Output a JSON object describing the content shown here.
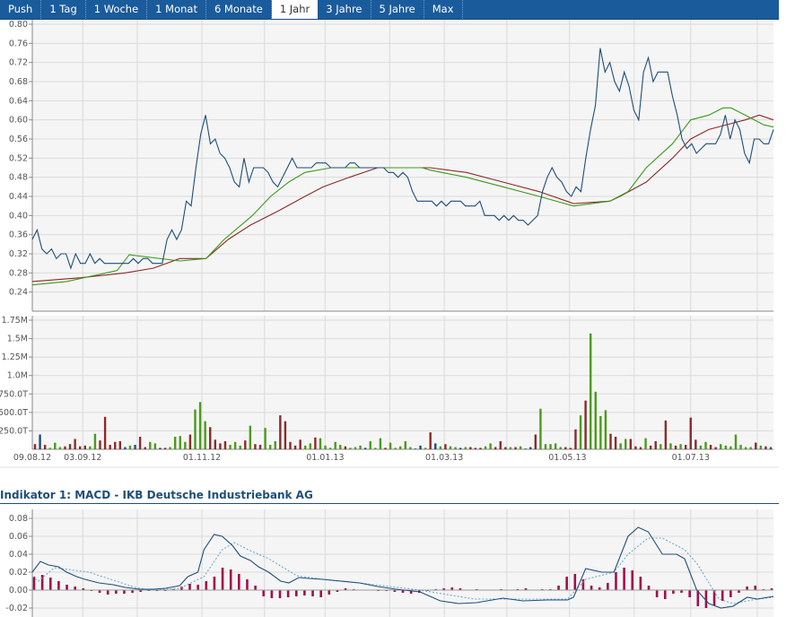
{
  "tabs": [
    {
      "label": "Push"
    },
    {
      "label": "1 Tag"
    },
    {
      "label": "1 Woche"
    },
    {
      "label": "1 Monat"
    },
    {
      "label": "6 Monate"
    },
    {
      "label": "1 Jahr",
      "active": true
    },
    {
      "label": "3 Jahre"
    },
    {
      "label": "5 Jahre"
    },
    {
      "label": "Max"
    }
  ],
  "indicator_title": "Indikator 1: MACD - IKB Deutsche Industriebank AG",
  "colors": {
    "price": "#1f4e78",
    "ma_short": "#3a9a1a",
    "ma_long": "#8b2a2a",
    "vol_up": "#4a9a1a",
    "vol_down": "#8b2a2a",
    "vol_neutral": "#1f4e78",
    "macd": "#1f4e78",
    "signal": "#6aaad0",
    "hist": "#a0104a"
  },
  "chart_data": [
    {
      "type": "line",
      "title": "Price",
      "x_unit": "days since 09.08.12",
      "xlim": [
        0,
        367
      ],
      "ylim": [
        0.2,
        0.8
      ],
      "yticks": [
        "0.80",
        "0.76",
        "0.72",
        "0.68",
        "0.64",
        "0.60",
        "0.56",
        "0.52",
        "0.48",
        "0.44",
        "0.40",
        "0.36",
        "0.32",
        "0.28",
        "0.24"
      ],
      "close": [
        0.35,
        0.37,
        0.33,
        0.32,
        0.33,
        0.31,
        0.32,
        0.32,
        0.29,
        0.32,
        0.3,
        0.3,
        0.32,
        0.3,
        0.31,
        0.3,
        0.3,
        0.3,
        0.3,
        0.3,
        0.3,
        0.31,
        0.3,
        0.31,
        0.31,
        0.3,
        0.3,
        0.3,
        0.35,
        0.37,
        0.35,
        0.37,
        0.43,
        0.42,
        0.5,
        0.57,
        0.61,
        0.55,
        0.56,
        0.53,
        0.52,
        0.5,
        0.47,
        0.46,
        0.52,
        0.47,
        0.5,
        0.5,
        0.5,
        0.49,
        0.47,
        0.46,
        0.48,
        0.5,
        0.52,
        0.5,
        0.5,
        0.5,
        0.5,
        0.51,
        0.51,
        0.51,
        0.5,
        0.5,
        0.5,
        0.5,
        0.51,
        0.51,
        0.5,
        0.5,
        0.5,
        0.5,
        0.5,
        0.5,
        0.49,
        0.49,
        0.48,
        0.49,
        0.48,
        0.45,
        0.43,
        0.43,
        0.43,
        0.43,
        0.42,
        0.43,
        0.42,
        0.43,
        0.43,
        0.43,
        0.42,
        0.42,
        0.42,
        0.43,
        0.4,
        0.4,
        0.4,
        0.39,
        0.4,
        0.39,
        0.4,
        0.39,
        0.39,
        0.38,
        0.39,
        0.4,
        0.45,
        0.48,
        0.5,
        0.48,
        0.47,
        0.45,
        0.44,
        0.46,
        0.45,
        0.52,
        0.58,
        0.63,
        0.75,
        0.7,
        0.72,
        0.68,
        0.66,
        0.7,
        0.67,
        0.62,
        0.6,
        0.7,
        0.73,
        0.68,
        0.7,
        0.7,
        0.7,
        0.65,
        0.61,
        0.56,
        0.54,
        0.55,
        0.53,
        0.54,
        0.55,
        0.55,
        0.55,
        0.57,
        0.61,
        0.56,
        0.6,
        0.58,
        0.53,
        0.51,
        0.56,
        0.56,
        0.55,
        0.55,
        0.58
      ],
      "ma_short": [
        [
          0,
          0.255
        ],
        [
          17,
          0.262
        ],
        [
          42,
          0.285
        ],
        [
          48,
          0.318
        ],
        [
          73,
          0.305
        ],
        [
          86,
          0.31
        ],
        [
          95,
          0.35
        ],
        [
          109,
          0.4
        ],
        [
          118,
          0.44
        ],
        [
          127,
          0.47
        ],
        [
          135,
          0.49
        ],
        [
          148,
          0.5
        ],
        [
          162,
          0.5
        ],
        [
          193,
          0.5
        ],
        [
          197,
          0.495
        ],
        [
          215,
          0.48
        ],
        [
          233,
          0.46
        ],
        [
          251,
          0.44
        ],
        [
          268,
          0.42
        ],
        [
          286,
          0.43
        ],
        [
          295,
          0.45
        ],
        [
          304,
          0.5
        ],
        [
          317,
          0.55
        ],
        [
          326,
          0.6
        ],
        [
          335,
          0.61
        ],
        [
          342,
          0.625
        ],
        [
          346,
          0.625
        ],
        [
          353,
          0.61
        ],
        [
          362,
          0.59
        ],
        [
          367,
          0.585
        ]
      ],
      "ma_long": [
        [
          0,
          0.262
        ],
        [
          24,
          0.27
        ],
        [
          46,
          0.28
        ],
        [
          60,
          0.29
        ],
        [
          73,
          0.31
        ],
        [
          86,
          0.31
        ],
        [
          97,
          0.35
        ],
        [
          108,
          0.38
        ],
        [
          122,
          0.41
        ],
        [
          135,
          0.44
        ],
        [
          144,
          0.46
        ],
        [
          157,
          0.48
        ],
        [
          171,
          0.5
        ],
        [
          197,
          0.5
        ],
        [
          215,
          0.49
        ],
        [
          233,
          0.47
        ],
        [
          251,
          0.45
        ],
        [
          268,
          0.425
        ],
        [
          286,
          0.43
        ],
        [
          291,
          0.44
        ],
        [
          304,
          0.47
        ],
        [
          317,
          0.52
        ],
        [
          326,
          0.56
        ],
        [
          335,
          0.58
        ],
        [
          344,
          0.59
        ],
        [
          353,
          0.6
        ],
        [
          360,
          0.61
        ],
        [
          367,
          0.6
        ]
      ]
    },
    {
      "type": "bar",
      "title": "Volume",
      "unit": "T (thousands)",
      "ylim": [
        0,
        1750
      ],
      "yticks": [
        "1.75M",
        "1.5M",
        "1.25M",
        "1.0M",
        "750.0T",
        "500.0T",
        "250.0T"
      ],
      "xticks": [
        {
          "label": "09.08.12",
          "day": 0
        },
        {
          "label": "03.09.12",
          "day": 25
        },
        {
          "label": "01.11.12",
          "day": 84
        },
        {
          "label": "01.01.13",
          "day": 145
        },
        {
          "label": "01.03.13",
          "day": 204
        },
        {
          "label": "01.05.13",
          "day": 265
        },
        {
          "label": "01.07.13",
          "day": 326
        }
      ],
      "gridline_days": [
        0,
        25,
        52,
        84,
        115,
        145,
        177,
        204,
        235,
        266,
        298,
        326,
        359
      ],
      "values": [
        70,
        200,
        60,
        20,
        90,
        30,
        40,
        70,
        140,
        40,
        50,
        40,
        210,
        120,
        440,
        60,
        100,
        110,
        30,
        50,
        60,
        170,
        30,
        100,
        80,
        20,
        20,
        30,
        170,
        180,
        100,
        200,
        540,
        640,
        380,
        300,
        130,
        80,
        110,
        60,
        100,
        50,
        120,
        320,
        70,
        60,
        290,
        60,
        110,
        460,
        380,
        100,
        50,
        130,
        50,
        80,
        160,
        150,
        50,
        20,
        100,
        60,
        40,
        20,
        30,
        50,
        20,
        110,
        20,
        150,
        20,
        90,
        20,
        40,
        110,
        30,
        10,
        50,
        20,
        230,
        80,
        40,
        70,
        40,
        30,
        20,
        30,
        30,
        20,
        20,
        40,
        80,
        30,
        110,
        30,
        30,
        30,
        40,
        10,
        30,
        200,
        550,
        70,
        70,
        80,
        30,
        30,
        20,
        270,
        460,
        660,
        1570,
        780,
        450,
        530,
        210,
        170,
        80,
        140,
        140,
        40,
        30,
        150,
        50,
        110,
        70,
        390,
        80,
        50,
        70,
        60,
        430,
        130,
        50,
        100,
        60,
        30,
        70,
        50,
        40,
        200,
        60,
        30,
        30,
        90,
        50,
        40,
        30
      ],
      "colors": "rbrgggrrrrrggrrrrrbgbrrggbrggggrgggrrrrgggrgrrgggrrrrrggrgggggrgggbgggrgggggbbgrbgrggbgrrrggrrrgrgbbrgggggrrrgrggggrrggrrrgrrgrgrgrrrggrrgggggggrgrbbg"
    },
    {
      "type": "line",
      "title": "Indikator 1: MACD - IKB Deutsche Industriebank AG",
      "xlim": [
        0,
        367
      ],
      "ylim": [
        -0.03,
        0.09
      ],
      "yticks": [
        "0.08",
        "0.06",
        "0.04",
        "0.02",
        "0.00",
        "-0.02"
      ],
      "macd": [
        [
          0,
          0.02
        ],
        [
          4,
          0.032
        ],
        [
          8,
          0.028
        ],
        [
          13,
          0.026
        ],
        [
          17,
          0.02
        ],
        [
          22,
          0.015
        ],
        [
          26,
          0.012
        ],
        [
          33,
          0.008
        ],
        [
          40,
          0.006
        ],
        [
          46,
          0.003
        ],
        [
          53,
          0.001
        ],
        [
          60,
          0.001
        ],
        [
          66,
          0.002
        ],
        [
          73,
          0.005
        ],
        [
          77,
          0.015
        ],
        [
          82,
          0.02
        ],
        [
          85,
          0.045
        ],
        [
          90,
          0.062
        ],
        [
          94,
          0.06
        ],
        [
          99,
          0.05
        ],
        [
          103,
          0.038
        ],
        [
          108,
          0.033
        ],
        [
          112,
          0.026
        ],
        [
          117,
          0.02
        ],
        [
          123,
          0.01
        ],
        [
          127,
          0.008
        ],
        [
          132,
          0.014
        ],
        [
          137,
          0.013
        ],
        [
          144,
          0.012
        ],
        [
          153,
          0.01
        ],
        [
          162,
          0.008
        ],
        [
          171,
          0.004
        ],
        [
          180,
          0.001
        ],
        [
          192,
          -0.002
        ],
        [
          202,
          -0.012
        ],
        [
          211,
          -0.015
        ],
        [
          220,
          -0.014
        ],
        [
          233,
          -0.009
        ],
        [
          243,
          -0.012
        ],
        [
          255,
          -0.011
        ],
        [
          265,
          -0.011
        ],
        [
          268,
          -0.008
        ],
        [
          274,
          0.024
        ],
        [
          282,
          0.02
        ],
        [
          288,
          0.02
        ],
        [
          295,
          0.06
        ],
        [
          300,
          0.07
        ],
        [
          305,
          0.065
        ],
        [
          312,
          0.04
        ],
        [
          319,
          0.04
        ],
        [
          323,
          0.035
        ],
        [
          329,
          0.0
        ],
        [
          335,
          -0.015
        ],
        [
          341,
          -0.02
        ],
        [
          347,
          -0.018
        ],
        [
          354,
          -0.008
        ],
        [
          359,
          -0.01
        ],
        [
          367,
          -0.007
        ]
      ],
      "signal": [
        [
          0,
          0.015
        ],
        [
          3,
          0.01
        ],
        [
          11,
          0.025
        ],
        [
          28,
          0.02
        ],
        [
          51,
          0.003
        ],
        [
          58,
          0.0
        ],
        [
          73,
          0.002
        ],
        [
          85,
          0.015
        ],
        [
          94,
          0.045
        ],
        [
          100,
          0.053
        ],
        [
          107,
          0.045
        ],
        [
          117,
          0.035
        ],
        [
          131,
          0.016
        ],
        [
          147,
          0.011
        ],
        [
          162,
          0.008
        ],
        [
          192,
          0.0
        ],
        [
          219,
          -0.01
        ],
        [
          265,
          -0.01
        ],
        [
          274,
          0.012
        ],
        [
          288,
          0.02
        ],
        [
          295,
          0.04
        ],
        [
          305,
          0.058
        ],
        [
          312,
          0.058
        ],
        [
          323,
          0.045
        ],
        [
          329,
          0.03
        ],
        [
          340,
          -0.01
        ],
        [
          347,
          -0.015
        ],
        [
          359,
          -0.01
        ],
        [
          367,
          -0.008
        ]
      ],
      "histogram": [
        0.015,
        0.017,
        0.014,
        0.01,
        0.006,
        0.004,
        0.002,
        -0.001,
        -0.003,
        -0.005,
        -0.004,
        -0.004,
        -0.003,
        -0.002,
        -0.001,
        -0.001,
        -0.001,
        0.001,
        0.004,
        0.007,
        0.006,
        0.01,
        0.015,
        0.025,
        0.023,
        0.018,
        0.012,
        0.005,
        -0.007,
        -0.009,
        -0.009,
        -0.008,
        -0.007,
        -0.006,
        -0.007,
        -0.008,
        -0.005,
        -0.002,
        0.002,
        0.001,
        0,
        0,
        -0.001,
        -0.001,
        -0.002,
        -0.003,
        -0.004,
        -0.003,
        -0.001,
        0.001,
        0.002,
        0.003,
        0.002,
        0,
        0.001,
        0,
        0,
        0.001,
        0,
        0.001,
        0.002,
        0,
        0.001,
        0.001,
        0.005,
        0.015,
        0.018,
        0.012,
        0.005,
        0.003,
        0.008,
        0.02,
        0.025,
        0.022,
        0.015,
        0.005,
        -0.008,
        -0.01,
        -0.004,
        -0.003,
        -0.008,
        -0.018,
        -0.02,
        -0.017,
        -0.012,
        -0.008,
        -0.003,
        0.004,
        0.005,
        0.001,
        0.002
      ]
    }
  ]
}
